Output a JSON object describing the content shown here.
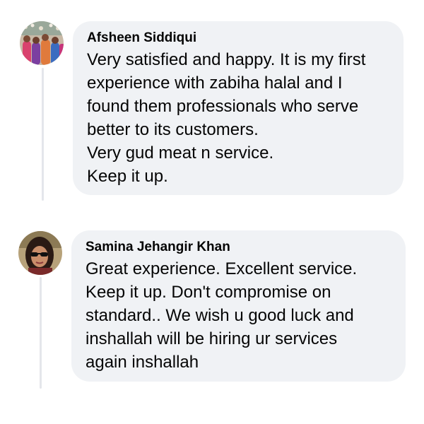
{
  "comments": [
    {
      "author": "Afsheen Siddiqui",
      "avatar_icon": "avatar-group-photo-icon",
      "lines": [
        "Very satisfied and happy. It is my first",
        "experience with zabiha halal and I",
        "found them professionals who serve",
        "better to its customers.",
        "Very gud meat n service.",
        "Keep it up."
      ]
    },
    {
      "author": "Samina Jehangir Khan",
      "avatar_icon": "avatar-woman-sunglasses-icon",
      "lines": [
        "Great experience. Excellent service.",
        "Keep it up. Don't compromise on",
        "standard.. We wish u good luck and",
        "inshallah will be hiring ur services",
        "again inshallah"
      ]
    }
  ],
  "colors": {
    "bubble": "#f0f2f5",
    "text": "#050505",
    "thread_line": "#e4e6eb"
  }
}
